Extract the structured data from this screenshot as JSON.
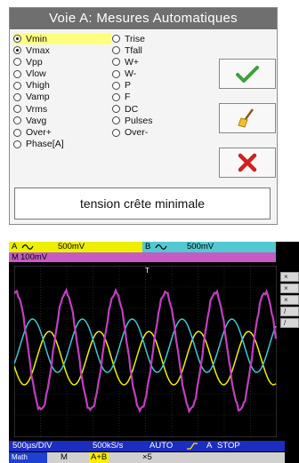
{
  "dialog": {
    "title": "Voie A: Mesures Automatiques",
    "col1": [
      "Vmin",
      "Vmax",
      "Vpp",
      "Vlow",
      "Vhigh",
      "Vamp",
      "Vrms",
      "Vavg",
      "Over+",
      "Phase[A]"
    ],
    "col2": [
      "Trise",
      "Tfall",
      "W+",
      "W-",
      "P",
      "F",
      "DC",
      "Pulses",
      "Over-"
    ],
    "description": "tension crête minimale",
    "buttons": {
      "ok": "check-icon",
      "clear": "broom-icon",
      "cancel": "cross-icon"
    }
  },
  "scope": {
    "chA_label": "A",
    "chA_scale": "500mV",
    "chB_label": "B",
    "chB_scale": "500mV",
    "math_label": "M",
    "math_scale": "100mV",
    "side_buttons": [
      "×",
      "×",
      "×",
      "/",
      "/"
    ],
    "status": {
      "timebase": "500µs/DIV",
      "rate": "500kS/s",
      "mode": "AUTO",
      "chan": "A",
      "state": "STOP"
    },
    "mathbar": {
      "math": "Math",
      "m": "M",
      "ab": "A+B",
      "zoom": "×5"
    },
    "trigger_marker": "T",
    "colors": {
      "chA": "#eeee00",
      "chB": "#52c8d0",
      "math": "#c45cc4",
      "status": "#1c2dbf"
    }
  }
}
